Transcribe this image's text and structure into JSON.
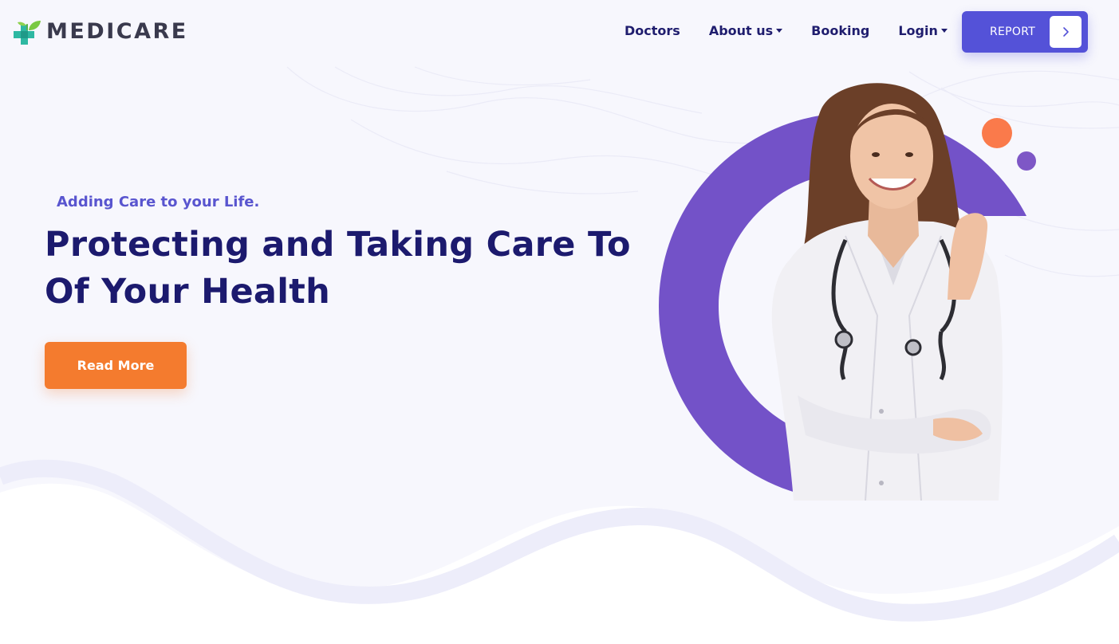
{
  "header": {
    "logo_text": "MEDICARE",
    "nav": [
      {
        "label": "Doctors",
        "dropdown": false
      },
      {
        "label": "About us",
        "dropdown": true
      },
      {
        "label": "Booking",
        "dropdown": false
      },
      {
        "label": "Login",
        "dropdown": true
      }
    ],
    "report_button": {
      "label": "REPORT",
      "icon": "chevron-right-icon"
    }
  },
  "hero": {
    "tagline": "Adding Care to your Life.",
    "headline": "Protecting and Taking Care To Of Your Health",
    "cta_label": "Read More",
    "image": "doctor-portrait"
  },
  "colors": {
    "brand_navy": "#1c1a6e",
    "accent_purple": "#5452d8",
    "ring_purple": "#7352c8",
    "cta_orange": "#f47b2e",
    "hero_background": "#f7f7fd"
  }
}
